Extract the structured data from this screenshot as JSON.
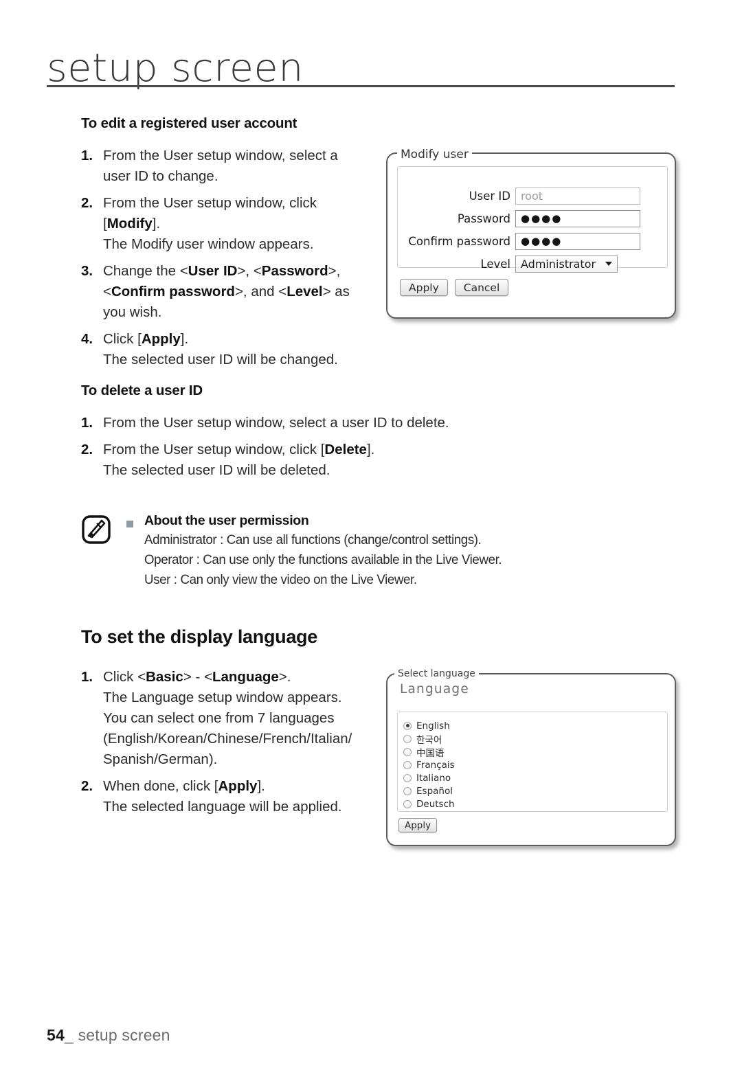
{
  "header": {
    "title": "setup screen"
  },
  "sections": {
    "edit_account": {
      "heading": "To edit a registered user account",
      "steps": [
        {
          "num": "1.",
          "lines": [
            [
              {
                "t": "From the User setup window, select a"
              }
            ],
            [
              {
                "t": "user ID to change."
              }
            ]
          ]
        },
        {
          "num": "2.",
          "lines": [
            [
              {
                "t": "From the User setup window, click"
              }
            ],
            [
              {
                "t": "["
              },
              {
                "t": "Modify",
                "b": true
              },
              {
                "t": "]."
              }
            ],
            [
              {
                "t": "The Modify user window appears."
              }
            ]
          ]
        },
        {
          "num": "3.",
          "lines": [
            [
              {
                "t": "Change the <"
              },
              {
                "t": "User ID",
                "b": true
              },
              {
                "t": ">, <"
              },
              {
                "t": "Password",
                "b": true
              },
              {
                "t": ">,"
              }
            ],
            [
              {
                "t": "<"
              },
              {
                "t": "Confirm password",
                "b": true
              },
              {
                "t": ">, and <"
              },
              {
                "t": "Level",
                "b": true
              },
              {
                "t": "> as"
              }
            ],
            [
              {
                "t": "you wish."
              }
            ]
          ]
        },
        {
          "num": "4.",
          "lines": [
            [
              {
                "t": "Click ["
              },
              {
                "t": "Apply",
                "b": true
              },
              {
                "t": "]."
              }
            ],
            [
              {
                "t": "The selected user ID will be changed."
              }
            ]
          ]
        }
      ]
    },
    "delete_user": {
      "heading": "To delete a user ID",
      "steps": [
        {
          "num": "1.",
          "lines": [
            [
              {
                "t": "From the User setup window, select a user ID to delete."
              }
            ]
          ]
        },
        {
          "num": "2.",
          "lines": [
            [
              {
                "t": "From the User setup window, click ["
              },
              {
                "t": "Delete",
                "b": true
              },
              {
                "t": "]."
              }
            ],
            [
              {
                "t": "The selected user ID will be deleted."
              }
            ]
          ]
        }
      ]
    },
    "note": {
      "title": "About the user permission",
      "lines": [
        "Administrator : Can use all functions (change/control settings).",
        "Operator : Can use only the functions available in the Live Viewer.",
        "User : Can only view the video on the Live Viewer."
      ]
    },
    "display_language": {
      "heading": "To set the display language",
      "steps": [
        {
          "num": "1.",
          "lines": [
            [
              {
                "t": "Click <"
              },
              {
                "t": "Basic",
                "b": true
              },
              {
                "t": "> - <"
              },
              {
                "t": "Language",
                "b": true
              },
              {
                "t": ">."
              }
            ],
            [
              {
                "t": "The Language setup window appears."
              }
            ],
            [
              {
                "t": "You can select one from 7 languages"
              }
            ],
            [
              {
                "t": "(English/Korean/Chinese/French/Italian/"
              }
            ],
            [
              {
                "t": "Spanish/German)."
              }
            ]
          ]
        },
        {
          "num": "2.",
          "lines": [
            [
              {
                "t": "When done, click ["
              },
              {
                "t": "Apply",
                "b": true
              },
              {
                "t": "]."
              }
            ],
            [
              {
                "t": "The selected language will be applied."
              }
            ]
          ]
        }
      ]
    }
  },
  "dialogs": {
    "modify_user": {
      "legend": "Modify user",
      "fields": [
        {
          "label": "User ID",
          "value": "root",
          "type": "text-readonly"
        },
        {
          "label": "Password",
          "value": "●●●●",
          "type": "password"
        },
        {
          "label": "Confirm password",
          "value": "●●●●",
          "type": "password"
        },
        {
          "label": "Level",
          "value": "Administrator",
          "type": "select"
        }
      ],
      "buttons": [
        "Apply",
        "Cancel"
      ]
    },
    "language": {
      "title": "Language",
      "legend": "Select language",
      "options": [
        {
          "label": "English",
          "selected": true
        },
        {
          "label": "한국어",
          "selected": false
        },
        {
          "label": "中国语",
          "selected": false
        },
        {
          "label": "Français",
          "selected": false
        },
        {
          "label": "Italiano",
          "selected": false
        },
        {
          "label": "Español",
          "selected": false
        },
        {
          "label": "Deutsch",
          "selected": false
        }
      ],
      "buttons": [
        "Apply"
      ]
    }
  },
  "footer": {
    "page_number": "54",
    "separator": "_",
    "label": "setup screen"
  },
  "colors": {
    "bullet": "#8e9ba6",
    "rule": "#4a4a4a",
    "dialog_border": "#5c5c5c"
  }
}
